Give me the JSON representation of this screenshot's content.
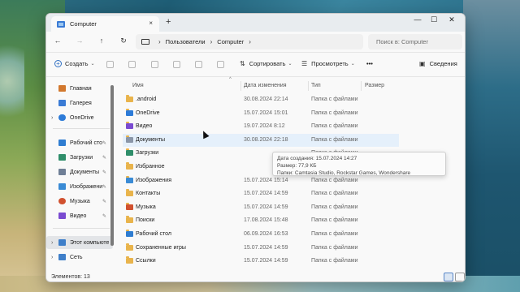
{
  "window": {
    "tab_title": "Computer",
    "tab_close": "×",
    "new_tab": "+",
    "minimize": "—",
    "maximize": "☐",
    "close": "✕"
  },
  "nav": {
    "back": "←",
    "forward": "→",
    "up": "↑",
    "refresh": "↻",
    "breadcrumb": [
      "Пользователи",
      "Computer"
    ],
    "breadcrumb_sep": "›",
    "search_placeholder": "Поиск в: Computer"
  },
  "toolbar": {
    "create_label": "Создать",
    "sort_label": "Сортировать",
    "view_label": "Просмотреть",
    "more_label": "•••",
    "details_label": "Сведения"
  },
  "sidebar": {
    "items": [
      {
        "label": "Главная",
        "icon": "home-icon",
        "color": "#d2782e"
      },
      {
        "label": "Галерея",
        "icon": "gallery-icon",
        "color": "#3a7bd5"
      },
      {
        "label": "OneDrive",
        "icon": "onedrive-icon",
        "color": "#2d7bd8"
      },
      {
        "label": "Рабочий сто",
        "icon": "desktop-icon",
        "color": "#2f7dd1"
      },
      {
        "label": "Загрузки",
        "icon": "downloads-icon",
        "color": "#2f8e6a"
      },
      {
        "label": "Документы",
        "icon": "documents-icon",
        "color": "#6f7f96"
      },
      {
        "label": "Изображени",
        "icon": "pictures-icon",
        "color": "#3a8bd5"
      },
      {
        "label": "Музыка",
        "icon": "music-icon",
        "color": "#d1512f"
      },
      {
        "label": "Видео",
        "icon": "video-icon",
        "color": "#7a4bd1"
      },
      {
        "label": "Этот компьюте",
        "icon": "this-pc-icon",
        "color": "#3f7fc9"
      },
      {
        "label": "Сеть",
        "icon": "network-icon",
        "color": "#3f7fc9"
      }
    ],
    "chevron": "›",
    "pin": "📌"
  },
  "columns": {
    "name": "Имя",
    "date": "Дата изменения",
    "type": "Тип",
    "size": "Размер",
    "sort_caret": "^"
  },
  "files": [
    {
      "name": ".android",
      "date": "30.08.2024 22:14",
      "type": "Папка с файлами",
      "icon": "folder-icon",
      "color": "#e9b44c"
    },
    {
      "name": "OneDrive",
      "date": "15.07.2024 15:01",
      "type": "Папка с файлами",
      "icon": "onedrive-icon",
      "color": "#2d7bd8"
    },
    {
      "name": "Видео",
      "date": "19.07.2024 8:12",
      "type": "Папка с файлами",
      "icon": "video-icon",
      "color": "#7a4bd1"
    },
    {
      "name": "Документы",
      "date": "30.08.2024 22:18",
      "type": "Папка с файлами",
      "icon": "documents-icon",
      "color": "#8a96a8"
    },
    {
      "name": "Загрузки",
      "date": "",
      "type": "Папка с файлами",
      "icon": "downloads-icon",
      "color": "#2f8e6a"
    },
    {
      "name": "Избранное",
      "date": "",
      "type": "Папка с файлами",
      "icon": "folder-icon",
      "color": "#e9b44c"
    },
    {
      "name": "Изображения",
      "date": "15.07.2024 15:14",
      "type": "Папка с файлами",
      "icon": "pictures-icon",
      "color": "#3a8bd5"
    },
    {
      "name": "Контакты",
      "date": "15.07.2024 14:59",
      "type": "Папка с файлами",
      "icon": "folder-icon",
      "color": "#e9b44c"
    },
    {
      "name": "Музыка",
      "date": "15.07.2024 14:59",
      "type": "Папка с файлами",
      "icon": "music-icon",
      "color": "#d1512f"
    },
    {
      "name": "Поиски",
      "date": "17.08.2024 15:48",
      "type": "Папка с файлами",
      "icon": "folder-icon",
      "color": "#e9b44c"
    },
    {
      "name": "Рабочий стол",
      "date": "06.09.2024 16:53",
      "type": "Папка с файлами",
      "icon": "desktop-icon",
      "color": "#2f7dd1"
    },
    {
      "name": "Сохраненные игры",
      "date": "15.07.2024 14:59",
      "type": "Папка с файлами",
      "icon": "folder-icon",
      "color": "#e9b44c"
    },
    {
      "name": "Ссылки",
      "date": "15.07.2024 14:59",
      "type": "Папка с файлами",
      "icon": "folder-icon",
      "color": "#e9b44c"
    }
  ],
  "tooltip": {
    "line1": "Дата создания: 15.07.2024 14:27",
    "line2": "Размер: 77,9 КБ",
    "line3": "Папки: Camtasia Studio, Rockstar Games, Wondershare"
  },
  "status": {
    "items_count": "Элементов: 13"
  }
}
